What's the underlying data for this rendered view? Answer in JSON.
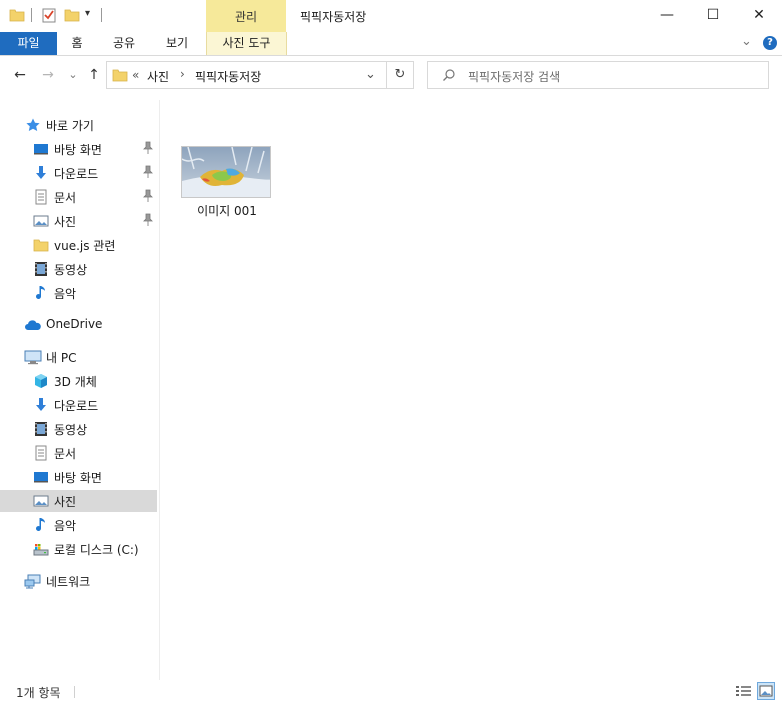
{
  "window": {
    "title": "픽픽자동저장",
    "contextual_tab_group": "관리"
  },
  "window_controls": {
    "minimize": "—",
    "maximize": "☐",
    "close": "✕"
  },
  "ribbon": {
    "tabs": [
      {
        "label": "파일"
      },
      {
        "label": "홈"
      },
      {
        "label": "공유"
      },
      {
        "label": "보기"
      },
      {
        "label": "사진 도구"
      }
    ],
    "expand": "⌄",
    "help": "?"
  },
  "nav_buttons": {
    "back": "←",
    "forward": "→",
    "recent": "⌄",
    "up": "↑"
  },
  "address": {
    "overflow": "«",
    "breadcrumb": [
      "사진",
      "픽픽자동저장"
    ],
    "separator": "›",
    "dropdown": "⌄",
    "refresh": "↻"
  },
  "search": {
    "placeholder": "픽픽자동저장 검색"
  },
  "nav_pane": {
    "quick_access": {
      "label": "바로 가기",
      "items": [
        {
          "label": "바탕 화면",
          "icon": "desktop-icon",
          "pinned": true
        },
        {
          "label": "다운로드",
          "icon": "download-icon",
          "pinned": true
        },
        {
          "label": "문서",
          "icon": "document-icon",
          "pinned": true
        },
        {
          "label": "사진",
          "icon": "pictures-icon",
          "pinned": true
        },
        {
          "label": "vue.js 관련",
          "icon": "folder-icon",
          "pinned": false
        },
        {
          "label": "동영상",
          "icon": "video-icon",
          "pinned": false
        },
        {
          "label": "음악",
          "icon": "music-icon",
          "pinned": false
        }
      ]
    },
    "onedrive": {
      "label": "OneDrive"
    },
    "this_pc": {
      "label": "내 PC",
      "items": [
        {
          "label": "3D 개체",
          "icon": "3d-objects-icon"
        },
        {
          "label": "다운로드",
          "icon": "download-icon"
        },
        {
          "label": "동영상",
          "icon": "video-icon"
        },
        {
          "label": "문서",
          "icon": "document-icon"
        },
        {
          "label": "바탕 화면",
          "icon": "desktop-icon"
        },
        {
          "label": "사진",
          "icon": "pictures-icon",
          "selected": true
        },
        {
          "label": "음악",
          "icon": "music-icon"
        },
        {
          "label": "로컬 디스크 (C:)",
          "icon": "drive-icon"
        }
      ]
    },
    "network": {
      "label": "네트워크"
    }
  },
  "files": [
    {
      "name": "이미지 001"
    }
  ],
  "status": {
    "item_count": "1개 항목"
  },
  "colors": {
    "accent": "#1f6cbf",
    "contextual_tab": "#f6e99a",
    "selected_bg": "#d9d9d9"
  }
}
